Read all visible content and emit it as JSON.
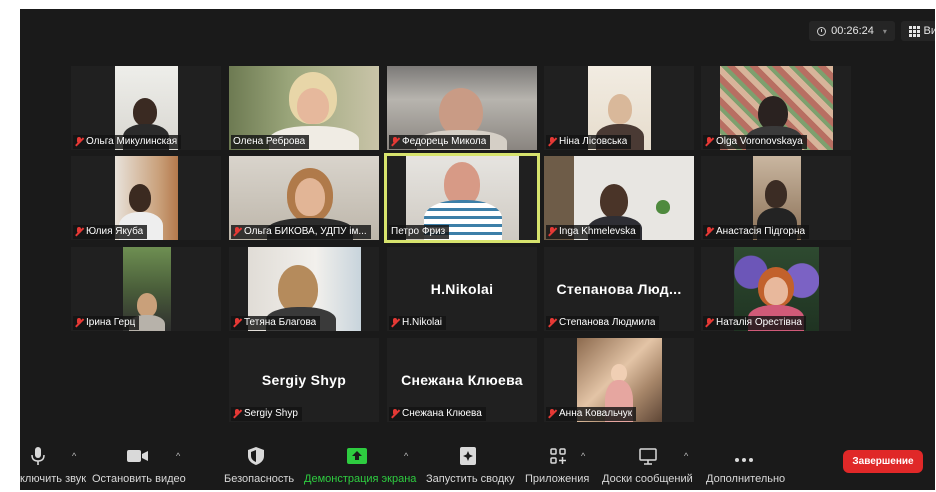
{
  "header": {
    "timer": "00:26:24",
    "view_label": "Вид"
  },
  "participants": [
    {
      "name": "Ольга Микулинская",
      "muted": true
    },
    {
      "name": "Олена Реброва",
      "muted": false
    },
    {
      "name": "Федорець Микола",
      "muted": true
    },
    {
      "name": "Ніна Лісовська",
      "muted": true
    },
    {
      "name": "Olga Voronovskaya",
      "muted": true
    },
    {
      "name": "Юлия Якуба",
      "muted": true
    },
    {
      "name": "Ольга БИКОВА, УДПУ ім...",
      "muted": true
    },
    {
      "name": "Петро Фриз",
      "muted": false,
      "speaking": true
    },
    {
      "name": "Inga Khmelevska",
      "muted": true
    },
    {
      "name": "Анастасія Підгорна",
      "muted": true
    },
    {
      "name": "Ірина Герц",
      "muted": true
    },
    {
      "name": "Тетяна Благова",
      "muted": true
    },
    {
      "name": "H.Nikolai",
      "muted": true,
      "display_name": "H.Nikolai"
    },
    {
      "name": "Степанова Людмила",
      "muted": true,
      "display_name": "Степанова Люд..."
    },
    {
      "name": "Наталія Орестівна",
      "muted": true
    },
    {
      "name": "Sergiy Shyp",
      "muted": true,
      "display_name": "Sergiy Shyp"
    },
    {
      "name": "Снежана Клюева",
      "muted": true,
      "display_name": "Снежана Клюева"
    },
    {
      "name": "Анна Ковальчук",
      "muted": true
    }
  ],
  "toolbar": {
    "mute_label": "ключить звук",
    "video_label": "Остановить видео",
    "security_label": "Безопасность",
    "share_label": "Демонстрация экрана",
    "summary_label": "Запустить сводку",
    "apps_label": "Приложения",
    "whiteboard_label": "Доски сообщений",
    "more_label": "Дополнительно",
    "end_label": "Завершение"
  },
  "colors": {
    "background": "#1a1a1a",
    "tile": "#202020",
    "active_speaker_border": "#d7e36d",
    "muted_red": "#e53935",
    "share_green": "#2ecc40",
    "end_button": "#e02828"
  }
}
